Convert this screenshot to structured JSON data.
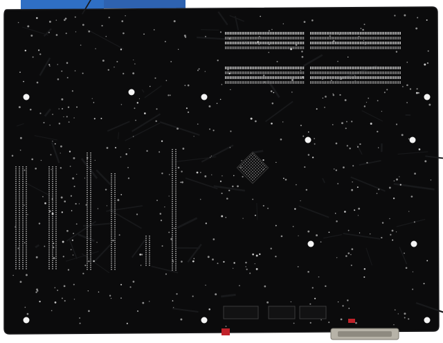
{
  "scene": {
    "subject": "motherboard-underside",
    "colors": {
      "background": "#ffffff",
      "pcb": "#0b0b0c",
      "pcb_edge": "#1a1a1c",
      "trace": "#18191b",
      "pin": "#8c8c8c",
      "pin_bright": "#c8c8c8",
      "hole": "#f4f4f4",
      "io_shield_blue": "#2f6fc4",
      "connector_metal": "#b7b3a8",
      "red_jumper": "#c0222a"
    }
  }
}
